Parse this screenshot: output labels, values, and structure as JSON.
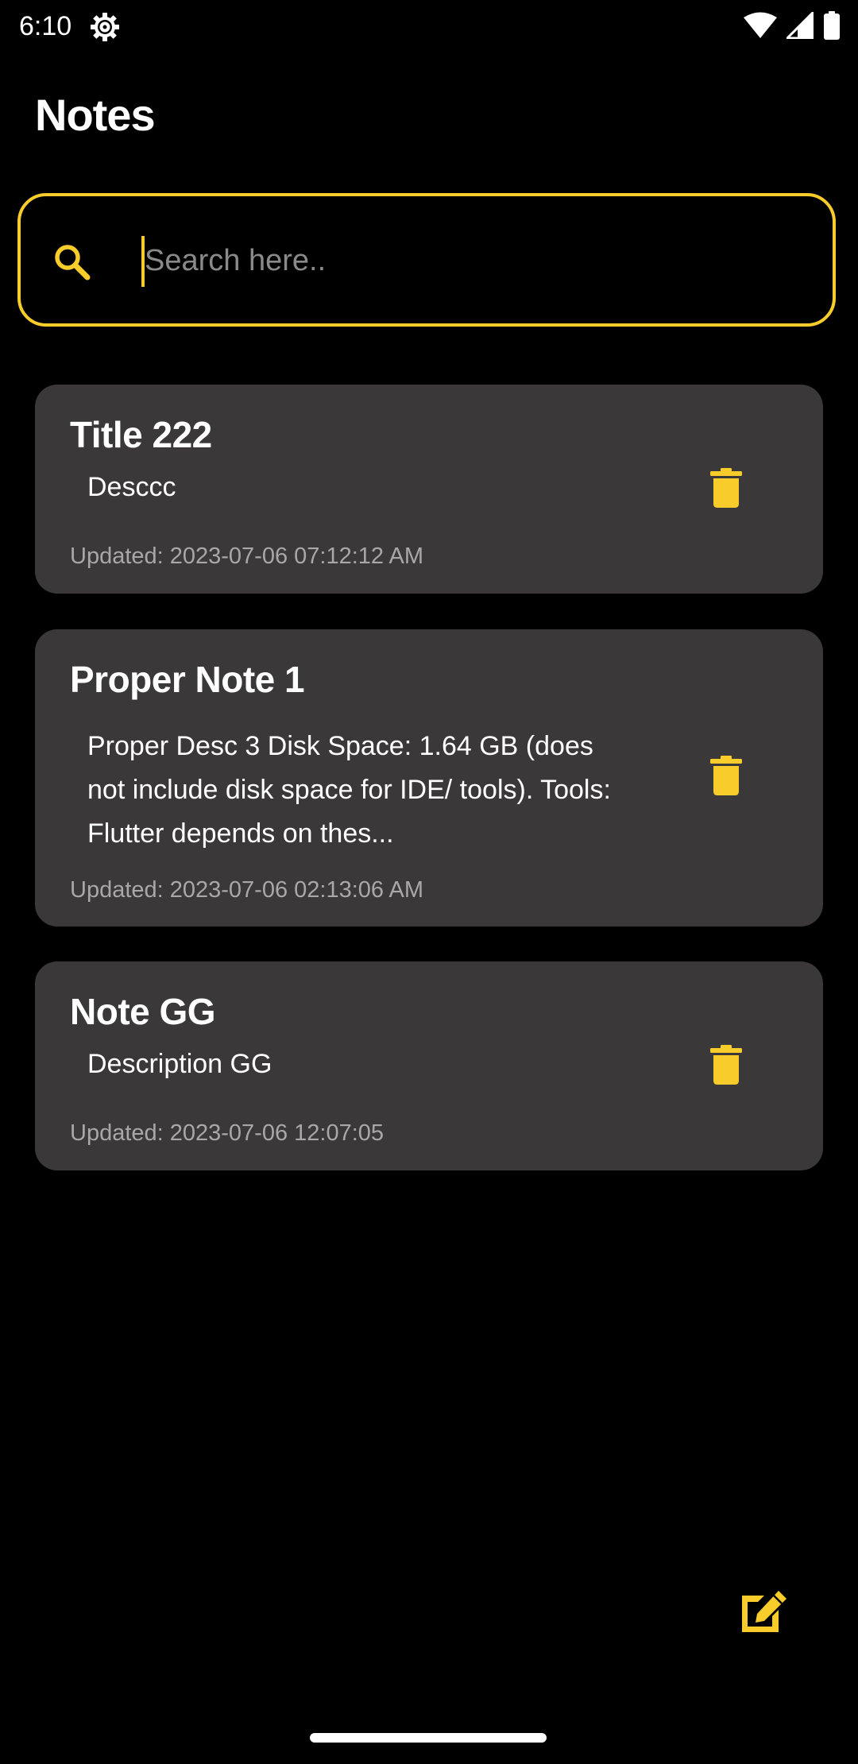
{
  "status_bar": {
    "time": "6:10",
    "icons": [
      "settings-gear-icon",
      "wifi-icon",
      "cellular-signal-icon",
      "battery-icon"
    ]
  },
  "header": {
    "title": "Notes"
  },
  "search": {
    "placeholder": "Search here..",
    "value": "",
    "icon": "search-icon"
  },
  "notes": [
    {
      "title": "Title 222",
      "description": "Desccc",
      "updated": "Updated: 2023-07-06 07:12:12 AM",
      "delete_icon": "trash-icon"
    },
    {
      "title": "Proper Note 1",
      "description": "Proper Desc 3 Disk Space: 1.64 GB (does not include disk space for IDE/ tools). Tools: Flutter depends on thes...",
      "updated": "Updated: 2023-07-06 02:13:06 AM",
      "delete_icon": "trash-icon"
    },
    {
      "title": "Note GG",
      "description": "Description GG",
      "updated": "Updated: 2023-07-06 12:07:05",
      "delete_icon": "trash-icon"
    }
  ],
  "fab": {
    "icon": "edit-note-icon"
  },
  "colors": {
    "background": "#000000",
    "card": "#3a3839",
    "accent": "#f8cc2a",
    "text_primary": "#ffffff",
    "text_secondary": "#a9a7a8",
    "placeholder": "#8a8a8a"
  }
}
